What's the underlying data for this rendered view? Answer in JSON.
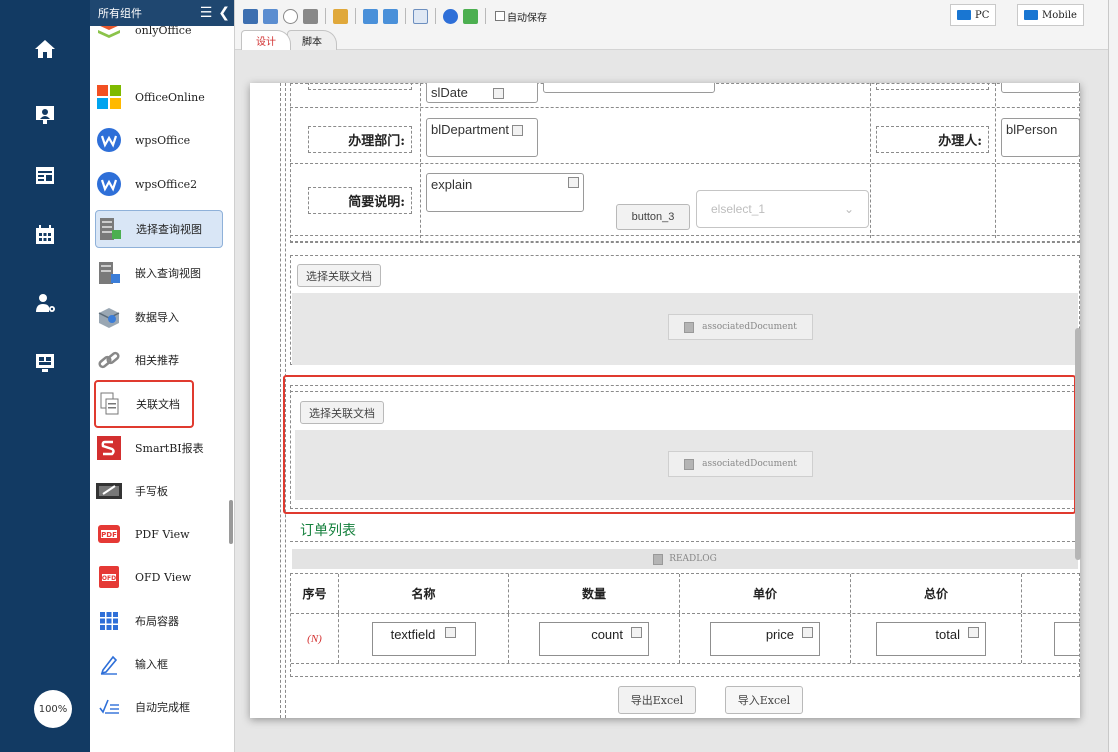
{
  "rail": {
    "items": [
      "home-icon",
      "presentation-icon",
      "calendar-icon",
      "calendar-grid-icon",
      "user-settings-icon",
      "monitor-icon"
    ],
    "zoom": "100%"
  },
  "component_panel": {
    "title": "所有组件",
    "items": [
      {
        "label": "onlyOffice",
        "icon": "onlyoffice-icon"
      },
      {
        "label": "OfficeOnline",
        "icon": "office-online-icon"
      },
      {
        "label": "wpsOffice",
        "icon": "wps-office-icon"
      },
      {
        "label": "wpsOffice2",
        "icon": "wps-office2-icon"
      },
      {
        "label": "选择查询视图",
        "icon": "select-query-view-icon"
      },
      {
        "label": "嵌入查询视图",
        "icon": "embed-query-view-icon"
      },
      {
        "label": "数据导入",
        "icon": "data-import-icon"
      },
      {
        "label": "相关推荐",
        "icon": "related-recommend-icon"
      },
      {
        "label": "关联文档",
        "icon": "associated-document-icon"
      },
      {
        "label": "SmartBI报表",
        "icon": "smartbi-icon"
      },
      {
        "label": "手写板",
        "icon": "handwriting-pad-icon"
      },
      {
        "label": "PDF View",
        "icon": "pdf-icon"
      },
      {
        "label": "OFD View",
        "icon": "ofd-icon"
      },
      {
        "label": "布局容器",
        "icon": "layout-container-icon"
      },
      {
        "label": "输入框",
        "icon": "input-box-icon"
      },
      {
        "label": "自动完成框",
        "icon": "autocomplete-icon"
      }
    ]
  },
  "toolbar": {
    "autosave_label": "自动保存",
    "device_pc": "PC",
    "device_mobile": "Mobile",
    "tabs": [
      "设计",
      "脚本"
    ],
    "colors": {
      "accent": "#1976d2",
      "active_tab_text": "#d12f2f",
      "selection_border": "#e03a2f"
    }
  },
  "form": {
    "date_field": "slDate",
    "dept_label": "办理部门:",
    "dept_field": "blDepartment",
    "person_label": "办理人:",
    "person_field": "blPerson",
    "desc_label": "简要说明:",
    "desc_field": "explain",
    "button3": "button_3",
    "select_placeholder": "elselect_1",
    "select_doc_btn": "选择关联文档",
    "assoc_doc": "associatedDocument",
    "order_title": "订单列表",
    "readlog": "READLOG",
    "table_headers": [
      "序号",
      "名称",
      "数量",
      "单价",
      "总价"
    ],
    "row_index": "(N)",
    "row_fields": [
      "textfield",
      "count",
      "price",
      "total"
    ],
    "export_btn": "导出Excel",
    "import_btn": "导入Excel"
  }
}
